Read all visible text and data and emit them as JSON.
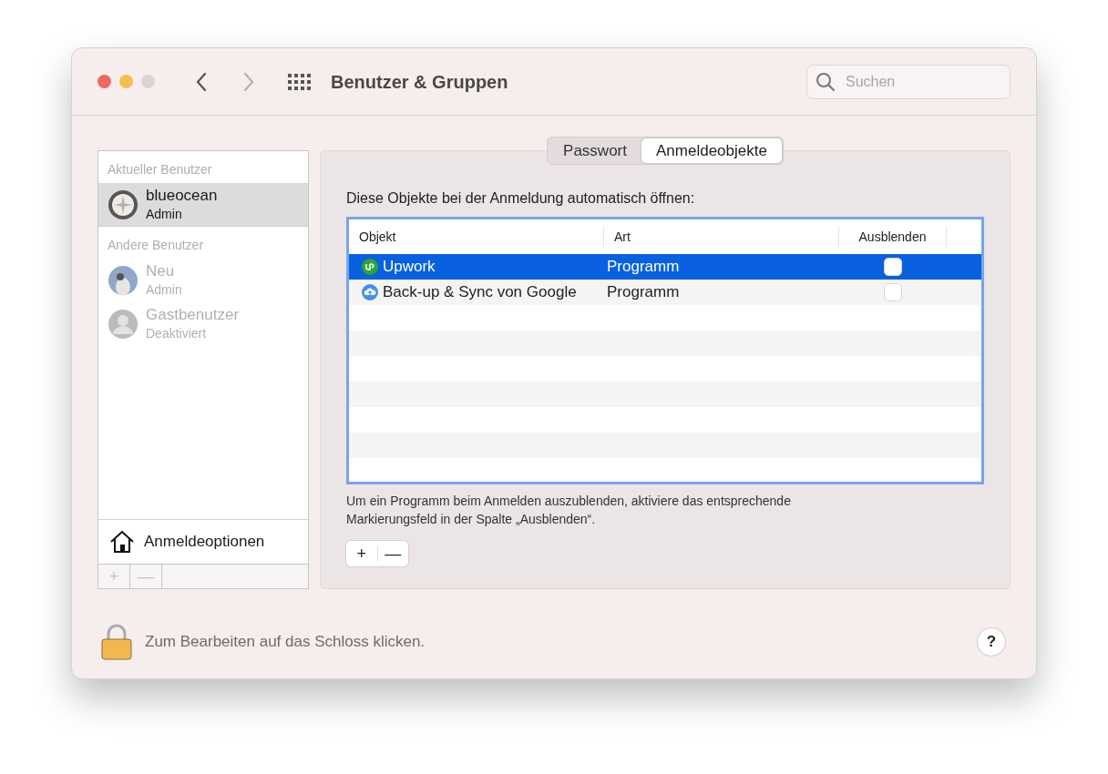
{
  "window": {
    "title": "Benutzer & Gruppen"
  },
  "nav": {
    "back_disabled": false,
    "forward_disabled": true
  },
  "search": {
    "placeholder": "Suchen"
  },
  "sidebar": {
    "sections": [
      {
        "heading": "Aktueller Benutzer",
        "users": [
          {
            "name": "blueocean",
            "role": "Admin",
            "selected": true,
            "disabled": false,
            "kind": "dial"
          }
        ]
      },
      {
        "heading": "Andere Benutzer",
        "users": [
          {
            "name": "Neu",
            "role": "Admin",
            "selected": false,
            "disabled": true,
            "kind": "photo"
          },
          {
            "name": "Gastbenutzer",
            "role": "Deaktiviert",
            "selected": false,
            "disabled": true,
            "kind": "guest"
          }
        ]
      }
    ],
    "options": "Anmeldeoptionen",
    "buttons": [
      {
        "label": "+",
        "disabled": true
      },
      {
        "label": "—",
        "disabled": true
      }
    ]
  },
  "tabs": [
    {
      "label": "Passwort",
      "selected": false
    },
    {
      "label": "Anmeldeobjekte",
      "selected": true
    }
  ],
  "login_items": {
    "heading": "Diese Objekte bei der Anmeldung automatisch öffnen:",
    "columns": [
      "Objekt",
      "Art",
      "Ausblenden"
    ],
    "rows": [
      {
        "name": "Upwork",
        "type": "Programm",
        "hide": false,
        "selected": true,
        "kind": "upwork"
      },
      {
        "name": "Back-up & Sync von Google",
        "type": "Programm",
        "hide": false,
        "selected": false,
        "kind": "cloud"
      }
    ],
    "hint": "Um ein Programm beim Anmelden auszublenden, aktiviere das entsprechende Markierungsfeld in der Spalte „Ausblenden“.",
    "buttons": [
      {
        "label": "+",
        "disabled": false
      },
      {
        "label": "—",
        "disabled": false
      }
    ]
  },
  "lock": {
    "text": "Zum Bearbeiten auf das Schloss klicken.",
    "locked": true
  },
  "help": "?"
}
